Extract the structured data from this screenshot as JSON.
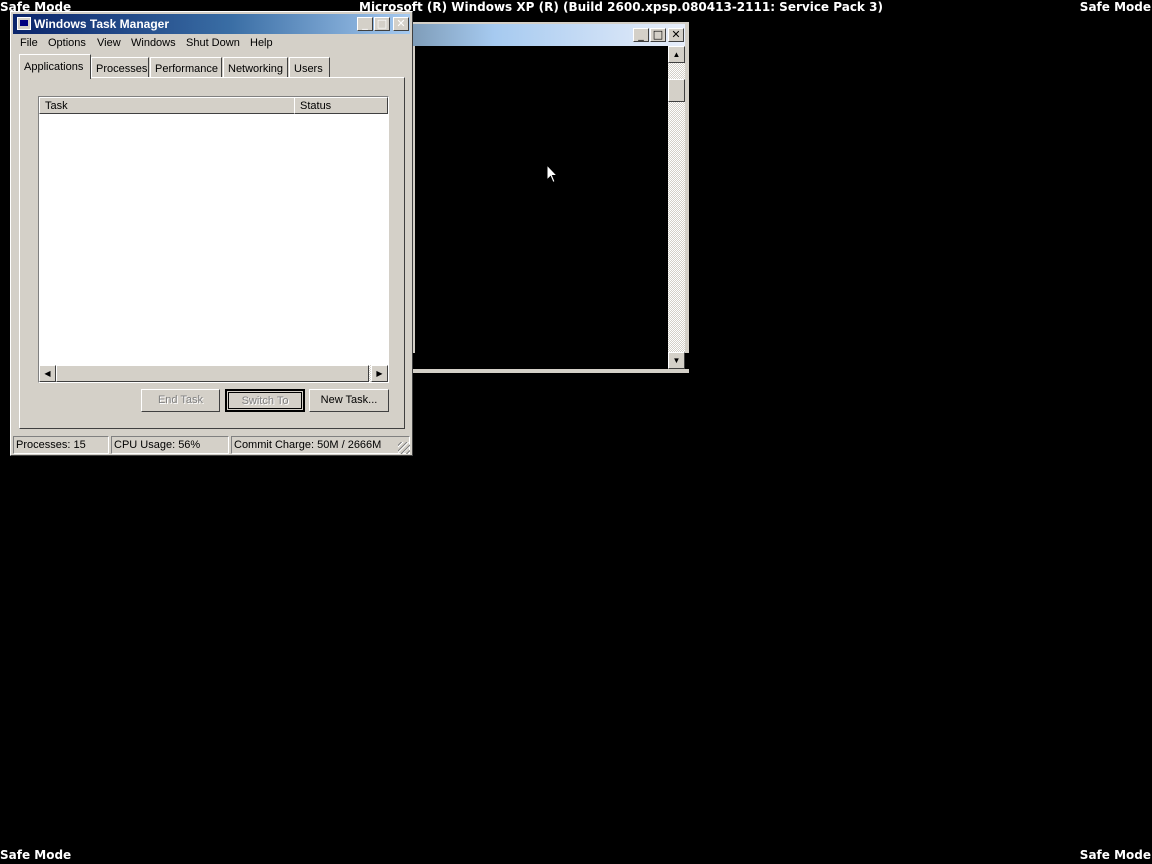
{
  "desktop": {
    "safe_mode_label": "Safe Mode",
    "os_build": "Microsoft (R) Windows XP (R) (Build 2600.xpsp.080413-2111: Service Pack 3)"
  },
  "task_manager": {
    "title": "Windows Task Manager",
    "menu": [
      "File",
      "Options",
      "View",
      "Windows",
      "Shut Down",
      "Help"
    ],
    "tabs": [
      "Applications",
      "Processes",
      "Performance",
      "Networking",
      "Users"
    ],
    "active_tab": "Applications",
    "columns": [
      "Task",
      "Status"
    ],
    "tasks": [],
    "buttons": {
      "end_task": "End Task",
      "switch_to": "Switch To",
      "new_task": "New Task..."
    },
    "status": {
      "processes": "Processes: 15",
      "cpu": "CPU Usage: 56%",
      "commit": "Commit Charge: 50M / 2666M"
    }
  },
  "caption_glyphs": {
    "minimize": "_",
    "maximize": "□",
    "close": "✕"
  },
  "scroll_glyphs": {
    "up": "▲",
    "down": "▼",
    "left": "◀",
    "right": "▶"
  }
}
